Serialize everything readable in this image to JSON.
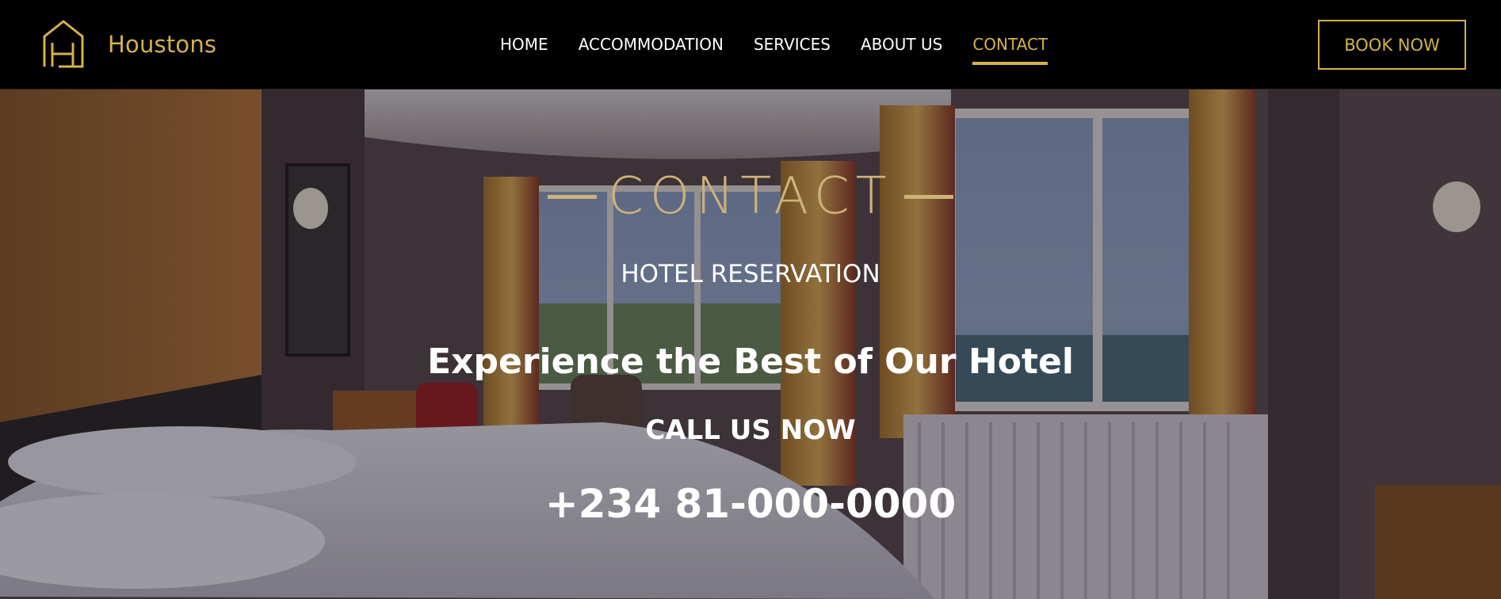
{
  "brand": {
    "name": "Houstons",
    "logo_icon": "house-h-logo-icon"
  },
  "nav": {
    "items": [
      {
        "label": "HOME"
      },
      {
        "label": "ACCOMMODATION"
      },
      {
        "label": "SERVICES"
      },
      {
        "label": "ABOUT US"
      },
      {
        "label": "CONTACT",
        "active": true
      }
    ]
  },
  "header": {
    "book_label": "BOOK NOW"
  },
  "hero": {
    "title": "CONTACT",
    "subtitle": "HOTEL RESERVATION",
    "headline": "Experience the Best of Our Hotel",
    "cta": "CALL US NOW",
    "phone": "+234 81-000-0000"
  },
  "colors": {
    "accent": "#d4b24a",
    "hero_title": "#cdb27a",
    "header_bg": "#000000",
    "text": "#ffffff"
  }
}
